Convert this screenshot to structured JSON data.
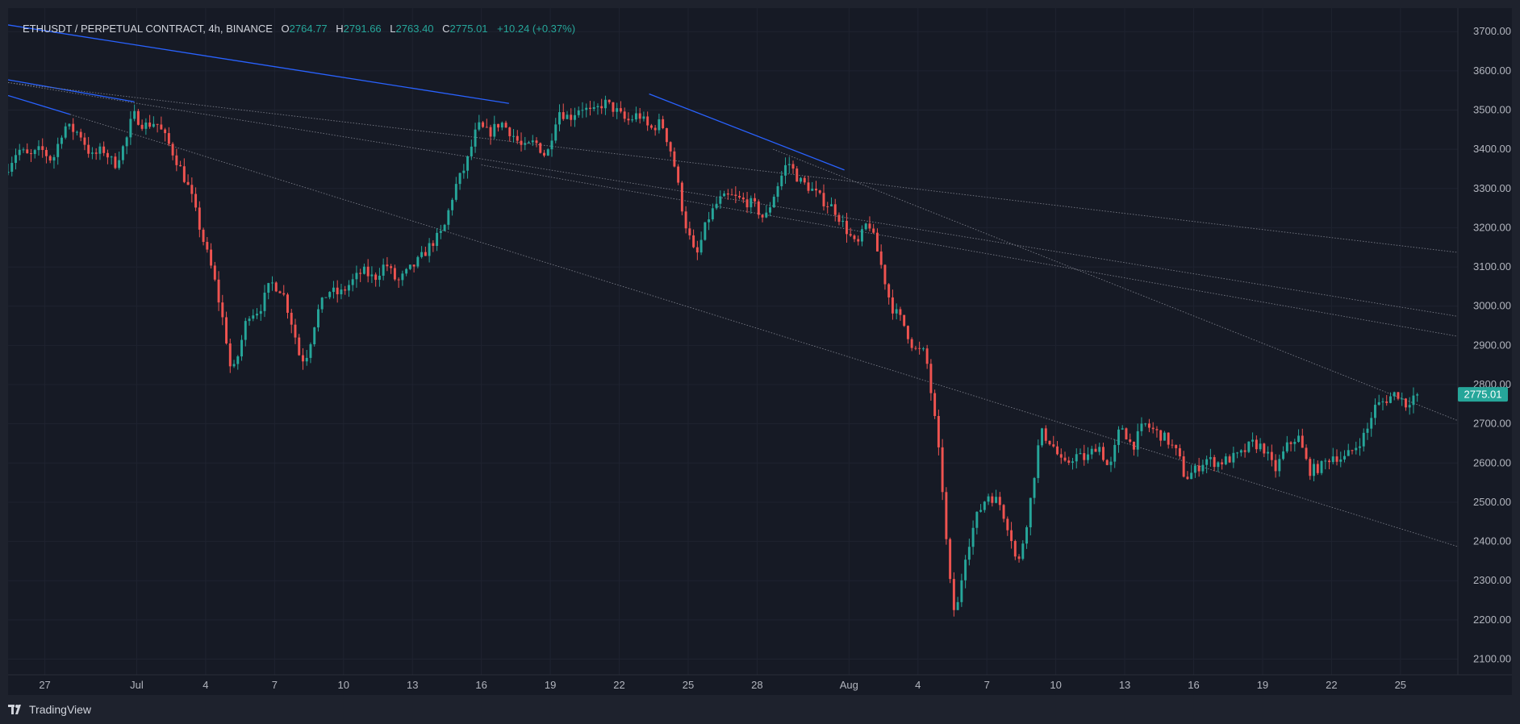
{
  "legend": {
    "symbol": "ETHUSDT / PERPETUAL CONTRACT, 4h, BINANCE",
    "open_label": "O",
    "open": "2764.77",
    "high_label": "H",
    "high": "2791.66",
    "low_label": "L",
    "low": "2763.40",
    "close_label": "C",
    "close": "2775.01",
    "change": "+10.24 (+0.37%)"
  },
  "brand": "TradingView",
  "colors": {
    "up": "#26a69a",
    "down": "#ef5350",
    "trendline": "#2962ff",
    "background": "#161a25",
    "price_tag": "#26a69a"
  },
  "chart_data": {
    "type": "candlestick",
    "symbol": "ETHUSDT",
    "timeframe": "4h",
    "exchange": "BINANCE",
    "last_price": 2775.01,
    "ylim": [
      2060,
      3760
    ],
    "y_ticks": [
      2100,
      2200,
      2300,
      2400,
      2500,
      2600,
      2700,
      2800,
      2900,
      3000,
      3100,
      3200,
      3300,
      3400,
      3500,
      3600,
      3700
    ],
    "y_tick_labels": [
      "2100.00",
      "2200.00",
      "2300.00",
      "2400.00",
      "2500.00",
      "2600.00",
      "2700.00",
      "2800.00",
      "2900.00",
      "3000.00",
      "3100.00",
      "3200.00",
      "3300.00",
      "3400.00",
      "3500.00",
      "3600.00",
      "3700.00"
    ],
    "x_ticks": [
      {
        "day": 27,
        "label": "27"
      },
      {
        "day": 31,
        "label": "Jul"
      },
      {
        "day": 34,
        "label": "4"
      },
      {
        "day": 37,
        "label": "7"
      },
      {
        "day": 40,
        "label": "10"
      },
      {
        "day": 43,
        "label": "13"
      },
      {
        "day": 46,
        "label": "16"
      },
      {
        "day": 49,
        "label": "19"
      },
      {
        "day": 52,
        "label": "22"
      },
      {
        "day": 55,
        "label": "25"
      },
      {
        "day": 58,
        "label": "28"
      },
      {
        "day": 62,
        "label": "Aug"
      },
      {
        "day": 65,
        "label": "4"
      },
      {
        "day": 68,
        "label": "7"
      },
      {
        "day": 71,
        "label": "10"
      },
      {
        "day": 74,
        "label": "13"
      },
      {
        "day": 77,
        "label": "16"
      },
      {
        "day": 80,
        "label": "19"
      },
      {
        "day": 83,
        "label": "22"
      },
      {
        "day": 86,
        "label": "25"
      }
    ],
    "x_unit": "days since June 1",
    "xlim": [
      25.4,
      88.5
    ],
    "anchors": [
      [
        25.4,
        3340
      ],
      [
        26.0,
        3400
      ],
      [
        26.5,
        3380
      ],
      [
        27.0,
        3400
      ],
      [
        27.5,
        3370
      ],
      [
        28.0,
        3460
      ],
      [
        28.7,
        3440
      ],
      [
        29.2,
        3380
      ],
      [
        29.7,
        3400
      ],
      [
        30.2,
        3360
      ],
      [
        30.7,
        3420
      ],
      [
        31.0,
        3490
      ],
      [
        31.5,
        3460
      ],
      [
        32.0,
        3470
      ],
      [
        32.5,
        3420
      ],
      [
        33.0,
        3360
      ],
      [
        33.5,
        3290
      ],
      [
        34.0,
        3180
      ],
      [
        34.5,
        3080
      ],
      [
        35.0,
        2940
      ],
      [
        35.3,
        2820
      ],
      [
        35.6,
        2880
      ],
      [
        36.0,
        2980
      ],
      [
        36.5,
        2990
      ],
      [
        37.0,
        3060
      ],
      [
        37.5,
        3040
      ],
      [
        38.0,
        2940
      ],
      [
        38.3,
        2860
      ],
      [
        38.6,
        2880
      ],
      [
        39.0,
        2980
      ],
      [
        39.5,
        3040
      ],
      [
        40.0,
        3030
      ],
      [
        40.5,
        3060
      ],
      [
        41.0,
        3090
      ],
      [
        41.5,
        3070
      ],
      [
        42.0,
        3110
      ],
      [
        42.5,
        3060
      ],
      [
        43.0,
        3090
      ],
      [
        43.5,
        3120
      ],
      [
        44.0,
        3160
      ],
      [
        44.5,
        3190
      ],
      [
        45.0,
        3300
      ],
      [
        45.5,
        3360
      ],
      [
        46.0,
        3460
      ],
      [
        46.5,
        3440
      ],
      [
        47.0,
        3470
      ],
      [
        47.5,
        3440
      ],
      [
        48.0,
        3400
      ],
      [
        48.5,
        3420
      ],
      [
        49.0,
        3380
      ],
      [
        49.5,
        3500
      ],
      [
        50.0,
        3480
      ],
      [
        50.5,
        3510
      ],
      [
        51.0,
        3490
      ],
      [
        51.5,
        3520
      ],
      [
        52.0,
        3500
      ],
      [
        52.5,
        3470
      ],
      [
        53.0,
        3490
      ],
      [
        53.5,
        3450
      ],
      [
        54.0,
        3470
      ],
      [
        54.5,
        3380
      ],
      [
        55.0,
        3220
      ],
      [
        55.5,
        3120
      ],
      [
        56.0,
        3220
      ],
      [
        56.5,
        3270
      ],
      [
        57.0,
        3280
      ],
      [
        57.5,
        3270
      ],
      [
        58.0,
        3260
      ],
      [
        58.5,
        3220
      ],
      [
        59.0,
        3300
      ],
      [
        59.5,
        3370
      ],
      [
        60.0,
        3320
      ],
      [
        60.5,
        3300
      ],
      [
        61.0,
        3270
      ],
      [
        61.5,
        3250
      ],
      [
        62.0,
        3200
      ],
      [
        62.5,
        3150
      ],
      [
        63.0,
        3220
      ],
      [
        63.5,
        3120
      ],
      [
        64.0,
        3000
      ],
      [
        64.5,
        2960
      ],
      [
        65.0,
        2890
      ],
      [
        65.5,
        2880
      ],
      [
        65.9,
        2710
      ],
      [
        66.2,
        2560
      ],
      [
        66.5,
        2320
      ],
      [
        66.8,
        2200
      ],
      [
        67.2,
        2360
      ],
      [
        67.7,
        2460
      ],
      [
        68.2,
        2520
      ],
      [
        68.7,
        2500
      ],
      [
        69.2,
        2420
      ],
      [
        69.5,
        2330
      ],
      [
        70.0,
        2480
      ],
      [
        70.5,
        2680
      ],
      [
        71.0,
        2650
      ],
      [
        71.5,
        2590
      ],
      [
        72.0,
        2620
      ],
      [
        72.5,
        2610
      ],
      [
        73.0,
        2650
      ],
      [
        73.5,
        2580
      ],
      [
        74.0,
        2700
      ],
      [
        74.5,
        2640
      ],
      [
        75.0,
        2700
      ],
      [
        75.5,
        2680
      ],
      [
        76.0,
        2660
      ],
      [
        76.5,
        2620
      ],
      [
        76.8,
        2560
      ],
      [
        77.2,
        2580
      ],
      [
        77.7,
        2610
      ],
      [
        78.2,
        2600
      ],
      [
        78.7,
        2610
      ],
      [
        79.2,
        2620
      ],
      [
        79.7,
        2650
      ],
      [
        80.2,
        2640
      ],
      [
        80.7,
        2580
      ],
      [
        81.2,
        2640
      ],
      [
        81.7,
        2670
      ],
      [
        82.2,
        2580
      ],
      [
        82.7,
        2590
      ],
      [
        83.2,
        2620
      ],
      [
        83.7,
        2610
      ],
      [
        84.2,
        2640
      ],
      [
        84.7,
        2680
      ],
      [
        85.0,
        2740
      ],
      [
        85.5,
        2760
      ],
      [
        86.0,
        2780
      ],
      [
        86.4,
        2750
      ],
      [
        86.8,
        2775
      ]
    ],
    "trendlines": [
      {
        "style": "solid",
        "from": [
          25.4,
          3717
        ],
        "to": [
          47.2,
          3517
        ]
      },
      {
        "style": "solid",
        "from": [
          25.4,
          3577
        ],
        "to": [
          30.9,
          3521
        ]
      },
      {
        "style": "solid",
        "from": [
          25.4,
          3537
        ],
        "to": [
          28.1,
          3489
        ]
      },
      {
        "style": "solid",
        "from": [
          53.3,
          3541
        ],
        "to": [
          61.8,
          3347
        ]
      },
      {
        "style": "dotted",
        "from": [
          25.4,
          3570
        ],
        "to": [
          88.5,
          3137
        ]
      },
      {
        "style": "dotted",
        "from": [
          25.4,
          3570
        ],
        "to": [
          88.5,
          2974
        ]
      },
      {
        "style": "dotted",
        "from": [
          46.0,
          3360
        ],
        "to": [
          88.5,
          2923
        ]
      },
      {
        "style": "dotted",
        "from": [
          28.1,
          3489
        ],
        "to": [
          88.5,
          2387
        ]
      },
      {
        "style": "dotted",
        "from": [
          58.7,
          3400
        ],
        "to": [
          88.5,
          2708
        ]
      }
    ]
  }
}
